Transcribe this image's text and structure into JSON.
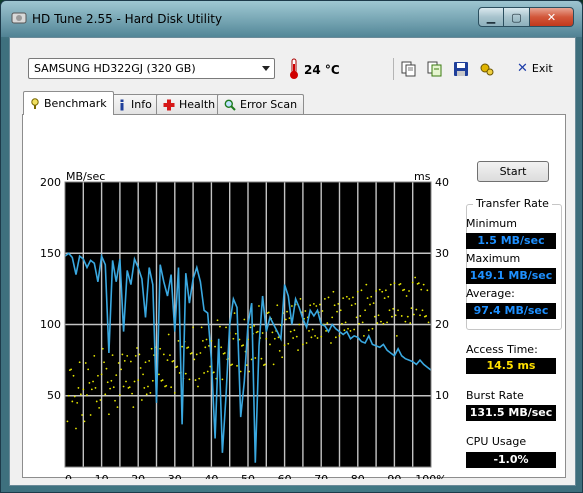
{
  "window": {
    "title": "HD Tune 2.55 - Hard Disk Utility"
  },
  "toolbar": {
    "drive": "SAMSUNG HD322GJ (320 GB)",
    "temperature": "24 °C",
    "exit_label": "Exit",
    "icons": [
      "copy-icon",
      "copy-text-icon",
      "save-icon",
      "options-icon"
    ]
  },
  "tabs": [
    {
      "label": "Benchmark",
      "active": true
    },
    {
      "label": "Info",
      "active": false
    },
    {
      "label": "Health",
      "active": false
    },
    {
      "label": "Error Scan",
      "active": false
    }
  ],
  "controls": {
    "start_label": "Start"
  },
  "results": {
    "transfer_rate_title": "Transfer Rate",
    "minimum_label": "Minimum",
    "minimum_value": "1.5 MB/sec",
    "maximum_label": "Maximum",
    "maximum_value": "149.1 MB/sec",
    "average_label": "Average:",
    "average_value": "97.4 MB/sec",
    "access_label": "Access Time:",
    "access_value": "14.5 ms",
    "burst_label": "Burst Rate",
    "burst_value": "131.5 MB/sec",
    "cpu_label": "CPU Usage",
    "cpu_value": "-1.0%"
  },
  "colors": {
    "transfer_line": "#3aa8e0",
    "access_points": "#e6e600",
    "plot_background": "#000000",
    "grid": "#d8d8d8"
  },
  "chart_data": {
    "type": "line",
    "ylabel_left": "MB/sec",
    "ylabel_right": "ms",
    "yticks_left": [
      "200",
      "150",
      "100",
      "50"
    ],
    "yticks_right": [
      "40",
      "30",
      "20",
      "10"
    ],
    "xticks": [
      "0",
      "10",
      "20",
      "30",
      "40",
      "50",
      "60",
      "70",
      "80",
      "90",
      "100%"
    ],
    "ylim_left": [
      0,
      200
    ],
    "ylim_right": [
      0,
      40
    ],
    "xlim": [
      0,
      100
    ],
    "grid": true,
    "series": [
      {
        "axis": "left",
        "x": [
          0,
          1,
          2,
          3,
          4,
          5,
          6,
          7,
          8,
          9,
          10,
          11,
          12,
          13,
          14,
          15,
          16,
          17,
          18,
          19,
          20,
          21,
          22,
          23,
          24,
          25,
          26,
          27,
          28,
          29,
          30,
          31,
          32,
          33,
          34,
          35,
          36,
          37,
          38,
          39,
          40,
          41,
          42,
          43,
          44,
          45,
          46,
          47,
          48,
          49,
          50,
          51,
          52,
          53,
          54,
          55,
          56,
          57,
          58,
          59,
          60,
          61,
          62,
          63,
          64,
          65,
          66,
          67,
          68,
          69,
          70,
          71,
          72,
          73,
          74,
          75,
          76,
          77,
          78,
          79,
          80,
          81,
          82,
          83,
          84,
          85,
          86,
          87,
          88,
          89,
          90,
          91,
          92,
          93,
          94,
          95,
          96,
          97,
          98,
          99,
          100
        ],
        "y": [
          148,
          150,
          147,
          135,
          148,
          146,
          140,
          145,
          143,
          130,
          148,
          142,
          80,
          145,
          130,
          146,
          95,
          138,
          128,
          146,
          140,
          132,
          105,
          140,
          128,
          45,
          142,
          130,
          120,
          135,
          95,
          140,
          30,
          136,
          115,
          132,
          140,
          130,
          110,
          108,
          75,
          20,
          90,
          10,
          50,
          100,
          118,
          112,
          35,
          60,
          100,
          115,
          3,
          85,
          120,
          95,
          105,
          100,
          95,
          90,
          128,
          120,
          100,
          118,
          112,
          104,
          98,
          110,
          106,
          110,
          100,
          99,
          95,
          100,
          97,
          95,
          93,
          95,
          90,
          92,
          91,
          88,
          87,
          92,
          86,
          85,
          84,
          86,
          82,
          80,
          78,
          83,
          78,
          76,
          75,
          74,
          72,
          75,
          72,
          70,
          68
        ]
      },
      {
        "axis": "right",
        "style": "scatter",
        "x": [
          1,
          2,
          3,
          4,
          5,
          6,
          7,
          8,
          9,
          10,
          11,
          12,
          13,
          14,
          15,
          16,
          17,
          18,
          19,
          20,
          21,
          22,
          23,
          24,
          25,
          26,
          27,
          28,
          29,
          30,
          31,
          32,
          33,
          34,
          35,
          36,
          37,
          38,
          39,
          40,
          41,
          42,
          43,
          44,
          45,
          46,
          47,
          48,
          49,
          50,
          51,
          52,
          53,
          54,
          55,
          56,
          57,
          58,
          59,
          60,
          61,
          62,
          63,
          64,
          65,
          66,
          67,
          68,
          69,
          70,
          71,
          72,
          73,
          74,
          75,
          76,
          77,
          78,
          79,
          80,
          81,
          82,
          83,
          84,
          85,
          86,
          87,
          88,
          89,
          90,
          91,
          92,
          93,
          94,
          95,
          96,
          97,
          98,
          99
        ],
        "y": [
          10,
          11,
          9,
          12,
          10,
          11,
          10,
          12,
          11,
          13,
          12,
          11,
          13,
          12,
          11,
          14,
          12,
          13,
          12,
          14,
          13,
          12,
          14,
          13,
          15,
          13,
          14,
          15,
          13,
          14,
          15,
          16,
          14,
          15,
          16,
          14,
          16,
          15,
          17,
          15,
          16,
          17,
          15,
          16,
          17,
          18,
          16,
          17,
          18,
          17,
          16,
          18,
          19,
          17,
          18,
          19,
          18,
          20,
          19,
          18,
          20,
          19,
          21,
          20,
          19,
          21,
          20,
          22,
          19,
          21,
          20,
          22,
          21,
          20,
          22,
          21,
          23,
          20,
          22,
          21,
          23,
          22,
          21,
          23,
          22,
          24,
          21,
          23,
          22,
          24,
          22,
          23,
          24,
          22,
          25,
          23,
          24,
          22,
          23
        ]
      }
    ]
  }
}
